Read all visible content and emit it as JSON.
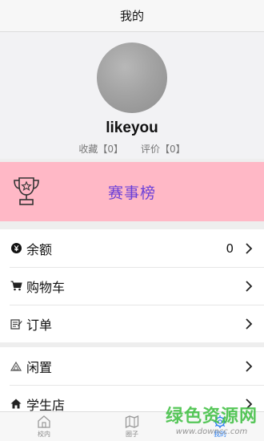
{
  "header": {
    "title": "我的"
  },
  "profile": {
    "username": "likeyou",
    "favorites_label": "收藏【0】",
    "reviews_label": "评价【0】"
  },
  "banner": {
    "title": "赛事榜",
    "icon": "trophy-icon"
  },
  "menu_group_1": [
    {
      "label": "余额",
      "value": "0",
      "icon": "yen-icon"
    },
    {
      "label": "购物车",
      "icon": "cart-icon"
    },
    {
      "label": "订单",
      "icon": "order-icon"
    }
  ],
  "menu_group_2": [
    {
      "label": "闲置",
      "icon": "triangle-icon"
    },
    {
      "label": "学生店",
      "icon": "home-icon"
    }
  ],
  "tabbar": {
    "tabs": [
      {
        "label": "校内",
        "icon": "campus-icon"
      },
      {
        "label": "圈子",
        "icon": "map-icon"
      },
      {
        "label": "我的",
        "icon": "gear-icon",
        "active": true
      }
    ]
  },
  "watermark": {
    "title": "绿色资源网",
    "url": "www.downcc.com"
  },
  "colors": {
    "banner_bg": "#ffb8c6",
    "banner_text": "#6a3fd8",
    "active_tab": "#2a7ef0",
    "watermark_green": "#45c148"
  }
}
